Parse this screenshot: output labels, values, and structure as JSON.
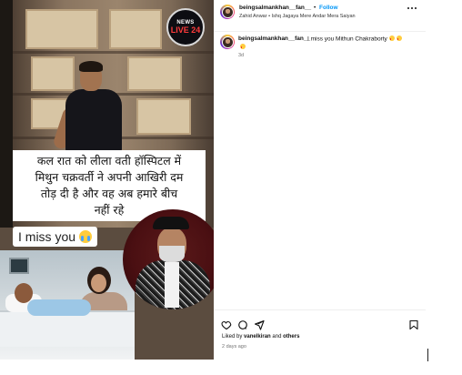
{
  "media": {
    "badge_top": "NEWS",
    "badge_bottom": "LIVE 24",
    "caption_lines": [
      "कल रात को लीला वती  हॉस्पिटल में",
      "मिथुन चक्रवर्ती ने अपनी आखिरी दम",
      "तोड़ दी  है और वह अब हमारे बीच",
      "नहीं रहे"
    ],
    "miss_text": "I miss you"
  },
  "post": {
    "username": "beingsalmankhan__fan__",
    "dot": "•",
    "follow_label": "Follow",
    "audio": "Zahid Anwar • Ishq Jagaya Mere Andar Mera Saiyan",
    "comment": {
      "username": "beingsalmankhan__fan__",
      "text": "I miss you Mithun Chakraborty",
      "time": "3d"
    },
    "liked_prefix": "Liked by",
    "liked_user": "vanelkiran",
    "liked_and": "and",
    "liked_others": "others",
    "posted_ago": "2 days ago"
  },
  "icons": {
    "more": "more-horizontal-icon",
    "like": "heart-icon",
    "comment": "comment-icon",
    "share": "share-icon",
    "save": "bookmark-icon",
    "follow_color": "#0095f6"
  }
}
